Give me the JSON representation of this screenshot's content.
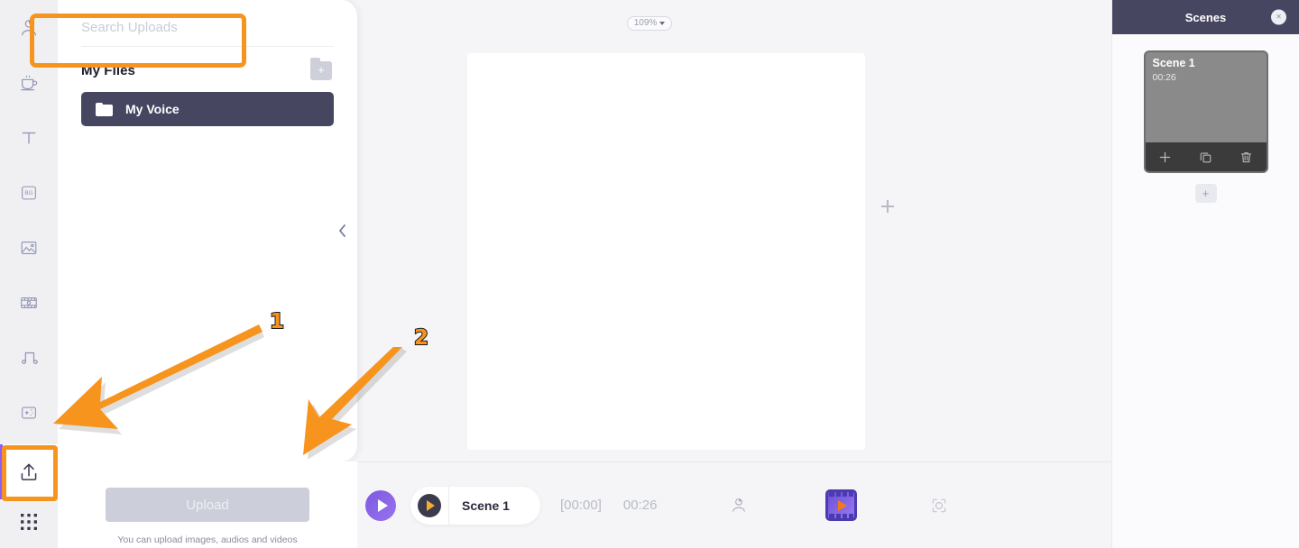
{
  "left_rail": {
    "items": [
      {
        "name": "avatar-icon",
        "label": "Avatar"
      },
      {
        "name": "coffee-icon",
        "label": "Templates"
      },
      {
        "name": "text-icon",
        "label": "Text"
      },
      {
        "name": "background-icon",
        "label": "BG"
      },
      {
        "name": "image-icon",
        "label": "Image"
      },
      {
        "name": "video-icon",
        "label": "Video"
      },
      {
        "name": "music-icon",
        "label": "Music"
      },
      {
        "name": "effects-icon",
        "label": "Effects"
      }
    ],
    "upload_item": {
      "name": "upload-icon",
      "label": "Upload"
    },
    "apps_item": {
      "name": "apps-grid-icon",
      "label": "Apps"
    }
  },
  "uploads_panel": {
    "search_placeholder": "Search Uploads",
    "search_value": "",
    "section_title": "My Files",
    "add_folder_label": "+",
    "folders": [
      {
        "label": "My Voice"
      }
    ],
    "collapse_label": "‹"
  },
  "upload_footer": {
    "button_label": "Upload",
    "hint": "You can upload images, audios and videos"
  },
  "stage": {
    "zoom_level": "109%",
    "add_label": "+"
  },
  "bottom_bar": {
    "play_label": "▶",
    "scene_chip_label": "Scene 1",
    "time_current": "[00:00]",
    "time_total": "00:26",
    "avatar_icon_label": "Avatar",
    "film_icon_label": "Video preview",
    "focus_icon_label": "Fit to screen"
  },
  "scenes_panel": {
    "title": "Scenes",
    "close_label": "×",
    "scenes": [
      {
        "name": "Scene 1",
        "duration": "00:26",
        "tools": {
          "add": "+",
          "duplicate": "Duplicate",
          "delete": "Delete"
        }
      }
    ],
    "add_scene_label": "+"
  },
  "annotations": [
    {
      "number": "1"
    },
    {
      "number": "2"
    }
  ],
  "colors": {
    "accent_purple": "#7b5ae0",
    "dark_navy": "#474660",
    "annotation_orange": "#F7941E",
    "amber": "#f2ae2e"
  }
}
